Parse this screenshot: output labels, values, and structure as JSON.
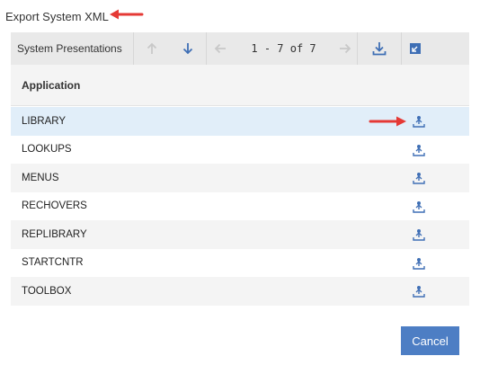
{
  "dialog": {
    "title": "Export System XML"
  },
  "toolbar": {
    "title": "System Presentations",
    "pager": "1 - 7 of 7",
    "icons": {
      "sort_up": "arrow-up-icon",
      "sort_down": "arrow-down-icon",
      "prev": "arrow-left-icon",
      "next": "arrow-right-icon",
      "download": "download-icon",
      "collapse": "collapse-icon"
    }
  },
  "table": {
    "column_header": "Application",
    "rows": [
      {
        "name": "LIBRARY",
        "action_icon": "export-icon",
        "selected": true
      },
      {
        "name": "LOOKUPS",
        "action_icon": "export-icon"
      },
      {
        "name": "MENUS",
        "action_icon": "export-icon"
      },
      {
        "name": "RECHOVERS",
        "action_icon": "export-icon"
      },
      {
        "name": "REPLIBRARY",
        "action_icon": "export-icon"
      },
      {
        "name": "STARTCNTR",
        "action_icon": "export-icon"
      },
      {
        "name": "TOOLBOX",
        "action_icon": "export-icon"
      }
    ]
  },
  "footer": {
    "cancel_label": "Cancel"
  },
  "colors": {
    "accent": "#4d7ec4",
    "selected_row": "#e1eef9",
    "annotation": "#e53935",
    "icon_blue": "#3f6fb5",
    "icon_disabled": "#c8c8c8"
  }
}
